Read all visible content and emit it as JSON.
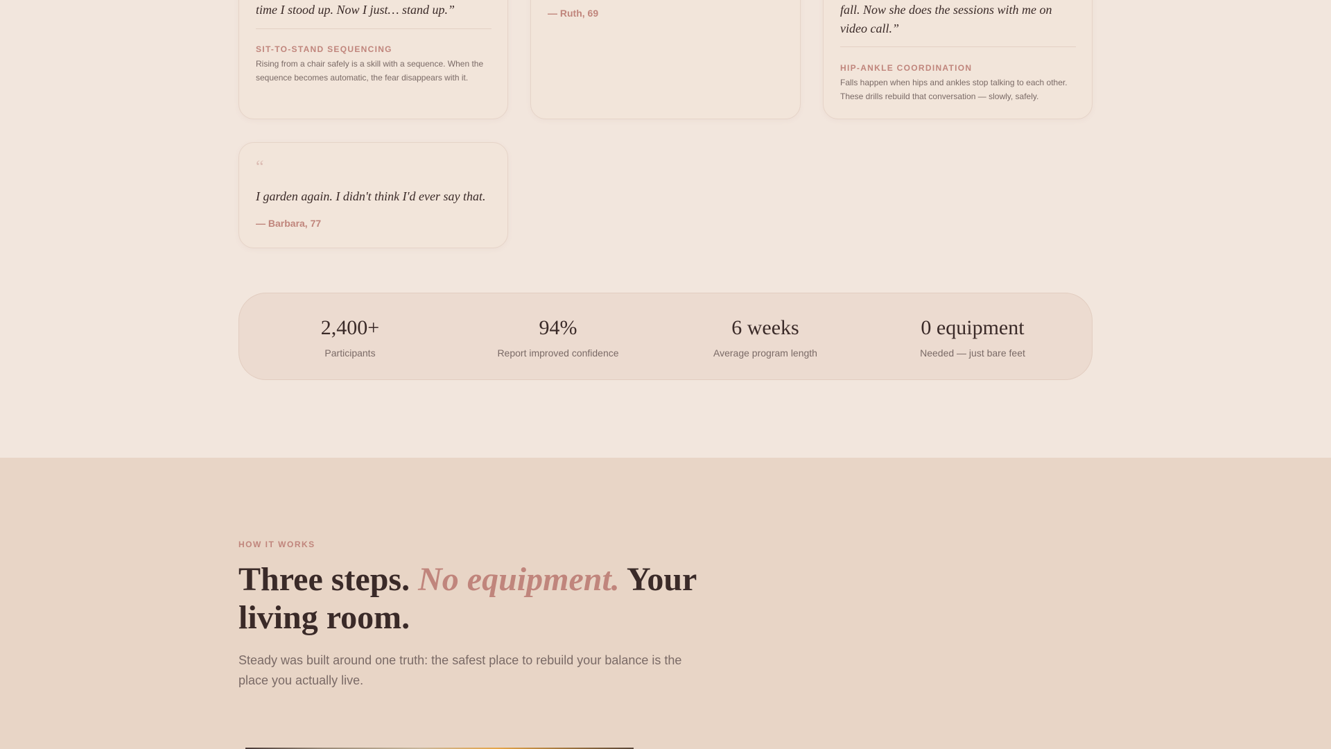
{
  "testimonials": [
    {
      "quote_tail": "time I stood up. Now I just… stand up.”",
      "tag": "SIT-TO-STAND SEQUENCING",
      "desc": "Rising from a chair safely is a skill with a sequence. When the sequence becomes automatic, the fear disappears with it."
    },
    {
      "author": "— Ruth, 69"
    },
    {
      "quote_tail": "fall. Now she does the sessions with me on video call.”",
      "tag": "HIP-ANKLE COORDINATION",
      "desc": "Falls happen when hips and ankles stop talking to each other. These drills rebuild that conversation — slowly, safely."
    },
    {
      "open_mark": "“",
      "quote": "I garden again. I didn't think I'd ever say that.",
      "author": "— Barbara, 77"
    }
  ],
  "stats": [
    {
      "value": "2,400+",
      "label": "Participants"
    },
    {
      "value": "94%",
      "label": "Report improved confidence"
    },
    {
      "value": "6 weeks",
      "label": "Average program length"
    },
    {
      "value": "0 equipment",
      "label": "Needed — just bare feet"
    }
  ],
  "how_it_works": {
    "eyebrow": "HOW IT WORKS",
    "headline_part1": "Three steps. ",
    "headline_accent": "No equipment.",
    "headline_part2": " Your living room.",
    "lede": "Steady was built around one truth: the safest place to rebuild your balance is the place you actually live."
  },
  "colors": {
    "accent": "#c0857c",
    "background": "#f2e6dd",
    "section_bg": "#e8d5c6",
    "text": "#3a2a28",
    "muted": "#7a6a66"
  }
}
